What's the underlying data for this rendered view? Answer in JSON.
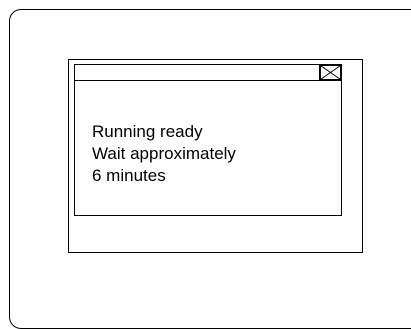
{
  "dialog": {
    "close_icon": "close-x-icon",
    "message_lines": [
      "Running ready",
      "Wait approximately",
      "6 minutes"
    ]
  }
}
